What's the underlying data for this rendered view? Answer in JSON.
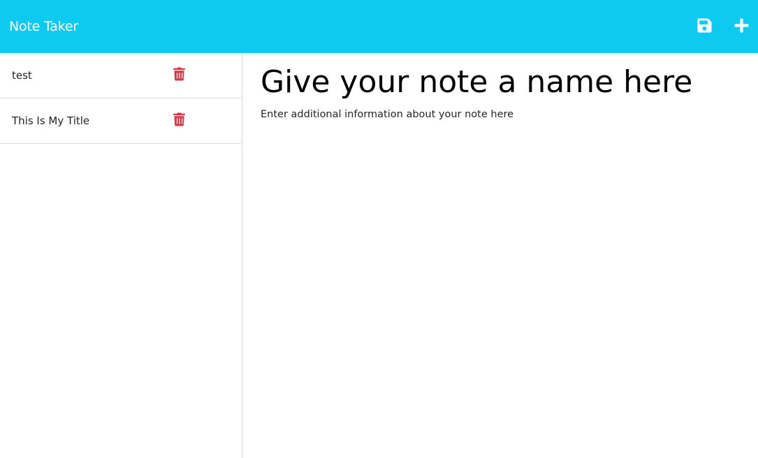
{
  "navbar": {
    "brand": "Note Taker",
    "save_icon": "save-icon",
    "add_icon": "plus-icon",
    "background": "#0dcaf0"
  },
  "notes": [
    {
      "title": "test",
      "delete_icon": "trash-icon"
    },
    {
      "title": "This Is My Title",
      "delete_icon": "trash-icon"
    }
  ],
  "editor": {
    "title_placeholder": "Give your note a name here",
    "text_placeholder": "Enter additional information about your note here"
  },
  "colors": {
    "accent": "#0dcaf0",
    "delete": "#dc3545"
  }
}
